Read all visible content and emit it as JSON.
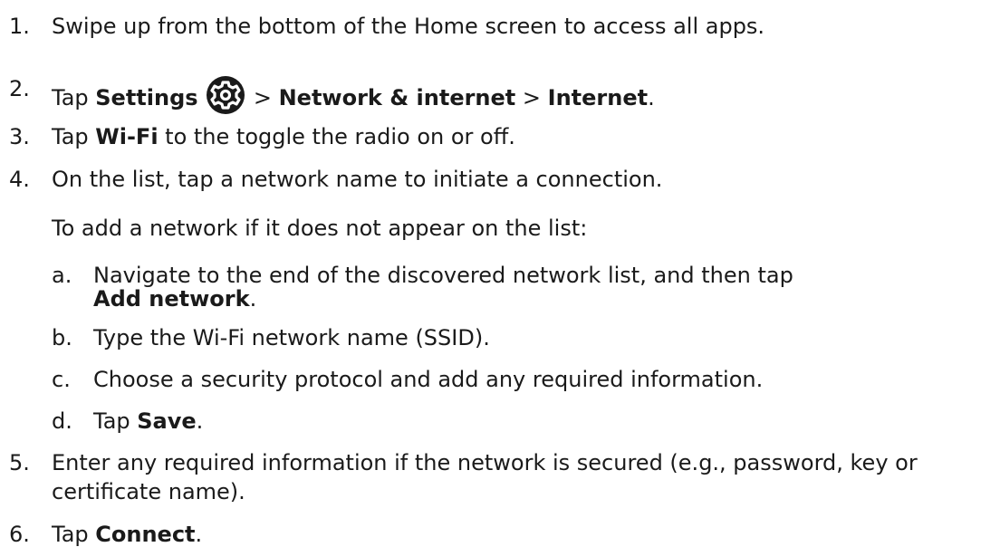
{
  "steps": [
    {
      "num": "1.",
      "text": "Swipe up from the bottom of the Home screen to access all apps."
    },
    {
      "num": "2.",
      "tap": "Tap ",
      "settings": "Settings",
      "sep1": " > ",
      "network": "Network & internet",
      "sep2": " > ",
      "internet": "Internet",
      "end": "."
    },
    {
      "num": "3.",
      "tap": "Tap ",
      "wifi": "Wi-Fi",
      "rest": " to the toggle the radio on or off."
    },
    {
      "num": "4.",
      "text": "On the list, tap a network name to initiate a connection.",
      "note": "To add a network if it does not appear on the list:"
    },
    {
      "num": "5.",
      "line1": "Enter any required information if the network is secured (e.g., password, key or",
      "line2": "certificate name)."
    },
    {
      "num": "6.",
      "tap": "Tap ",
      "connect": "Connect",
      "end": "."
    }
  ],
  "substeps": [
    {
      "letter": "a.",
      "line1": "Navigate to the end of the discovered network list, and then tap",
      "add": "Add network",
      "end": "."
    },
    {
      "letter": "b.",
      "text": "Type the Wi-Fi network name (SSID)."
    },
    {
      "letter": "c.",
      "text": "Choose a security protocol and add any required information."
    },
    {
      "letter": "d.",
      "tap": "Tap ",
      "save": "Save",
      "end": "."
    }
  ],
  "icons": {
    "settings": "gear-icon"
  }
}
